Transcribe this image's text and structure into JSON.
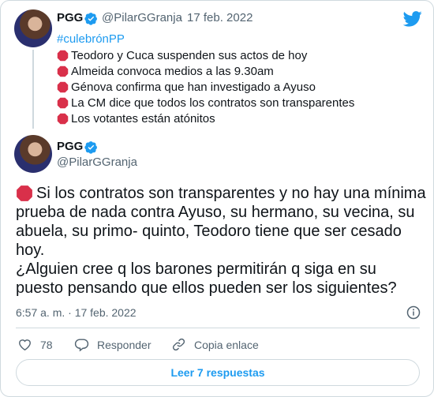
{
  "quoted": {
    "name": "PGG",
    "handle": "@PilarGGranja",
    "date_sep": "·",
    "date": "17 feb. 2022",
    "hashtag": "#culebrónPP",
    "lines": [
      "Teodoro y Cuca suspenden sus actos de hoy",
      "Almeida convoca medios a las 9.30am",
      "Génova confirma que han investigado a Ayuso",
      "La CM dice que todos los contratos son transparentes",
      "Los votantes están atónitos"
    ]
  },
  "tweet": {
    "name": "PGG",
    "handle": "@PilarGGranja",
    "lines": [
      "Si los contratos son transparentes y no hay una mínima",
      "prueba de nada contra Ayuso, su hermano, su vecina, su",
      "abuela, su primo- quinto, Teodoro tiene que ser cesado",
      "hoy.",
      "¿Alguien cree q los barones permitirán q siga en su",
      "puesto pensando que ellos pueden ser los siguientes?"
    ],
    "timestamp": "6:57 a. m. · 17 feb. 2022"
  },
  "actions": {
    "likes": "78",
    "reply_label": "Responder",
    "copy_label": "Copia enlace"
  },
  "more_button": "Leer 7 respuestas",
  "colors": {
    "accent": "#1d9bf0",
    "text": "#0f1419",
    "muted": "#536471",
    "border": "#cfd9de",
    "stop": "#d9304a"
  },
  "icons": [
    "twitter-logo-icon",
    "verified-badge-icon",
    "stop-sign-icon",
    "info-icon",
    "heart-icon",
    "reply-icon",
    "link-icon"
  ]
}
